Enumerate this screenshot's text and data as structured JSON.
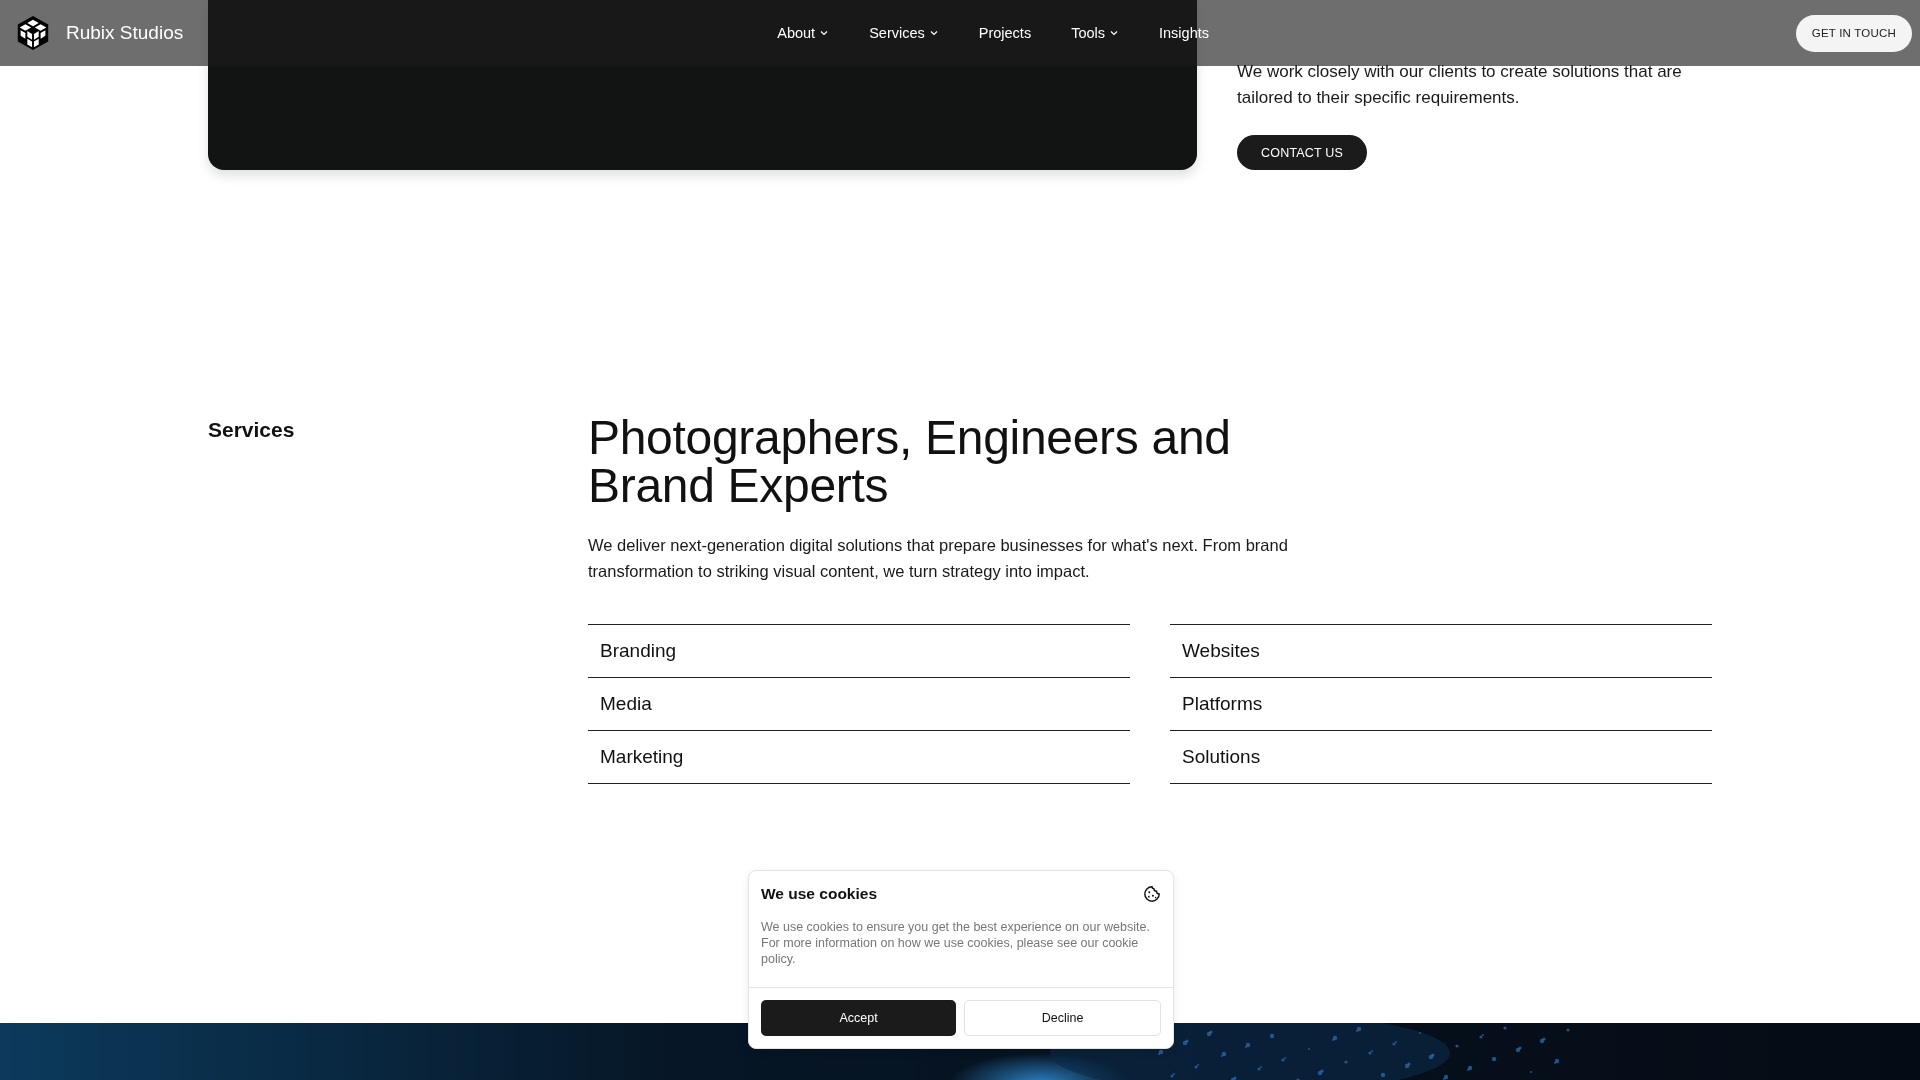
{
  "header": {
    "brand": "Rubix Studios",
    "nav": [
      {
        "label": "About",
        "dropdown": true
      },
      {
        "label": "Services",
        "dropdown": true
      },
      {
        "label": "Projects",
        "dropdown": false
      },
      {
        "label": "Tools",
        "dropdown": true
      },
      {
        "label": "Insights",
        "dropdown": false
      }
    ],
    "cta": "GET IN TOUCH"
  },
  "intro": {
    "text": "We work closely with our clients to create solutions that are tailored to their specific requirements.",
    "button": "CONTACT US"
  },
  "services": {
    "label": "Services",
    "heading": "Photographers, Engineers and Brand Experts",
    "description": "We deliver next-generation digital solutions that prepare businesses for what's next. From brand transformation to striking visual content, we turn strategy into impact.",
    "columns": [
      [
        "Branding",
        "Media",
        "Marketing"
      ],
      [
        "Websites",
        "Platforms",
        "Solutions"
      ]
    ]
  },
  "cookie_dialog": {
    "title": "We use cookies",
    "text": "We use cookies to ensure you get the best experience on our website. For more information on how we use cookies, please see our cookie policy.",
    "buttons": [
      {
        "label": "Accept",
        "kind": "primary"
      },
      {
        "label": "Decline",
        "kind": "secondary"
      }
    ]
  }
}
